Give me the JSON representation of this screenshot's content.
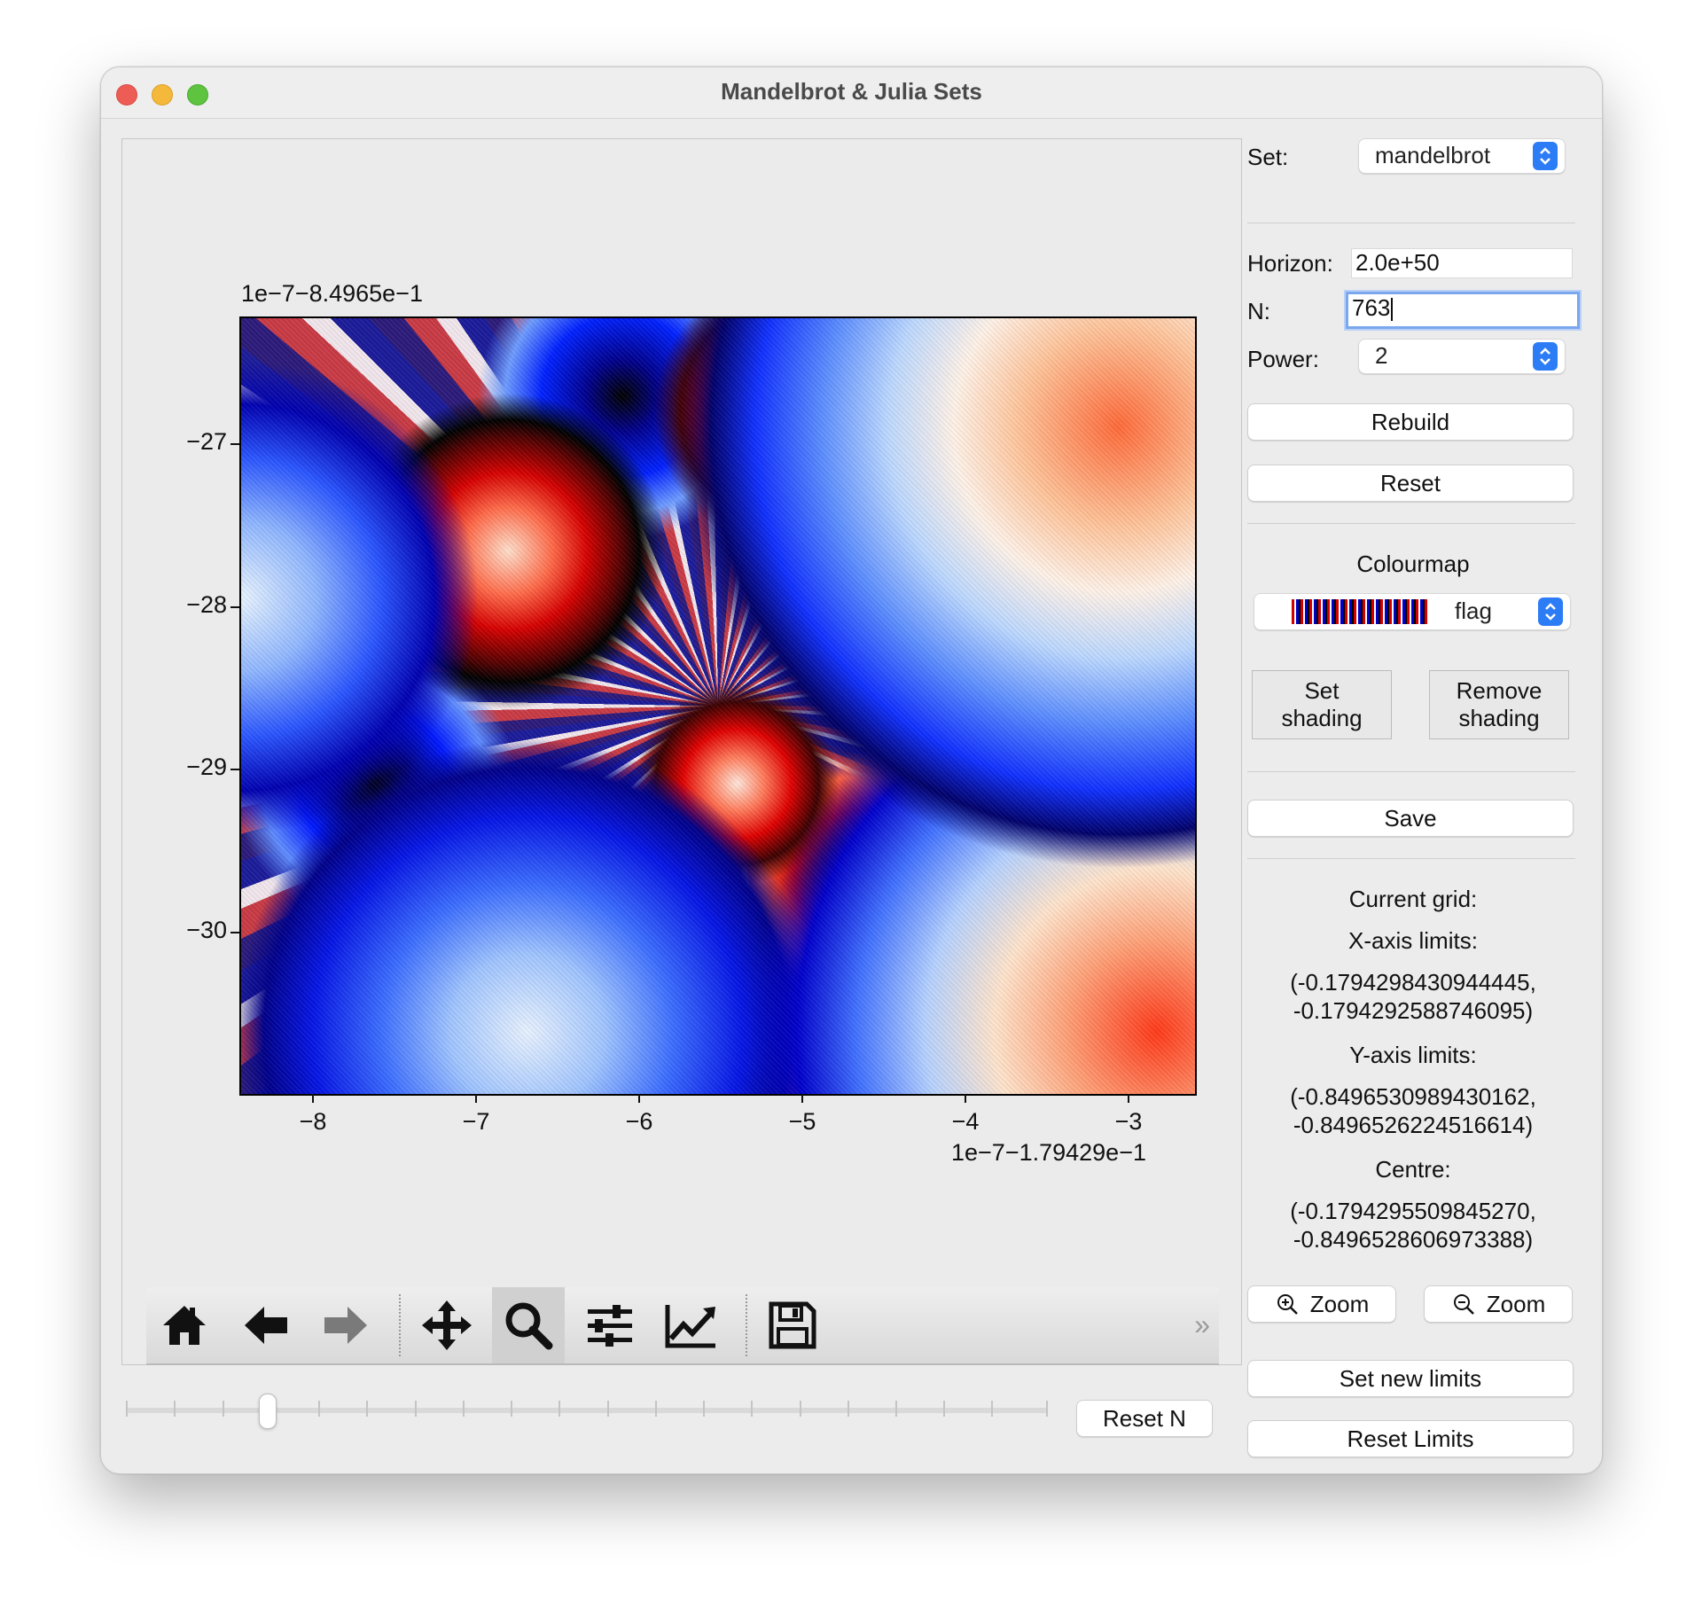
{
  "window": {
    "title": "Mandelbrot & Julia Sets"
  },
  "plot": {
    "y_offset_label": "1e−7−8.4965e−1",
    "x_offset_label": "1e−7−1.79429e−1",
    "y_ticks": [
      "−27",
      "−28",
      "−29",
      "−30"
    ],
    "x_ticks": [
      "−8",
      "−7",
      "−6",
      "−5",
      "−4",
      "−3"
    ],
    "colormap": "flag"
  },
  "toolbar": {
    "buttons": [
      {
        "name": "home-icon",
        "label": "Home"
      },
      {
        "name": "back-arrow-icon",
        "label": "Back"
      },
      {
        "name": "forward-arrow-icon",
        "label": "Forward"
      },
      {
        "name": "pan-icon",
        "label": "Pan"
      },
      {
        "name": "zoom-magnifier-icon",
        "label": "Zoom",
        "active": true
      },
      {
        "name": "sliders-icon",
        "label": "Configure subplots"
      },
      {
        "name": "line-chart-icon",
        "label": "Edit axis"
      },
      {
        "name": "save-disk-icon",
        "label": "Save figure"
      }
    ],
    "more": "»"
  },
  "bottom": {
    "reset_n_label": "Reset N",
    "slider_value_fraction": 0.15
  },
  "controls": {
    "set_label": "Set:",
    "set_value": "mandelbrot",
    "horizon_label": "Horizon:",
    "horizon_value": "2.0e+50",
    "n_label": "N:",
    "n_value": "763",
    "power_label": "Power:",
    "power_value": "2",
    "rebuild_label": "Rebuild",
    "reset_label": "Reset",
    "colourmap_label": "Colourmap",
    "colourmap_value": "flag",
    "set_shading_label": "Set\nshading",
    "remove_shading_label": "Remove\nshading",
    "save_label": "Save",
    "current_grid_label": "Current grid:",
    "x_axis_limits_label": "X-axis limits:",
    "x_axis_limits_line1": "(-0.1794298430944445,",
    "x_axis_limits_line2": "-0.1794292588746095)",
    "y_axis_limits_label": "Y-axis limits:",
    "y_axis_limits_line1": "(-0.8496530989430162,",
    "y_axis_limits_line2": "-0.8496526224516614)",
    "centre_label": "Centre:",
    "centre_line1": "(-0.1794295509845270,",
    "centre_line2": "-0.8496528606973388)",
    "zoom_in_label": "Zoom",
    "zoom_out_label": "Zoom",
    "set_new_limits_label": "Set new limits",
    "reset_limits_label": "Reset Limits"
  },
  "colors": {
    "accent": "#2c7cf6",
    "focus_ring": "#7aa7ee"
  }
}
